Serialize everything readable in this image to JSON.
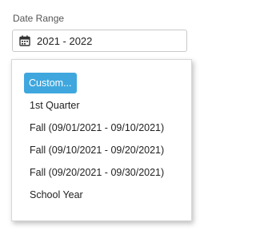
{
  "date_range": {
    "label": "Date Range",
    "value": "2021 - 2022",
    "icon": "calendar-icon"
  },
  "dropdown": {
    "options": [
      {
        "label": "Custom...",
        "selected": true
      },
      {
        "label": "1st Quarter"
      },
      {
        "label": "Fall (09/01/2021 - 09/10/2021)"
      },
      {
        "label": "Fall (09/10/2021 - 09/20/2021)"
      },
      {
        "label": "Fall (09/20/2021 - 09/30/2021)"
      },
      {
        "label": "School Year"
      }
    ]
  },
  "colors": {
    "accent": "#3fa7de"
  }
}
